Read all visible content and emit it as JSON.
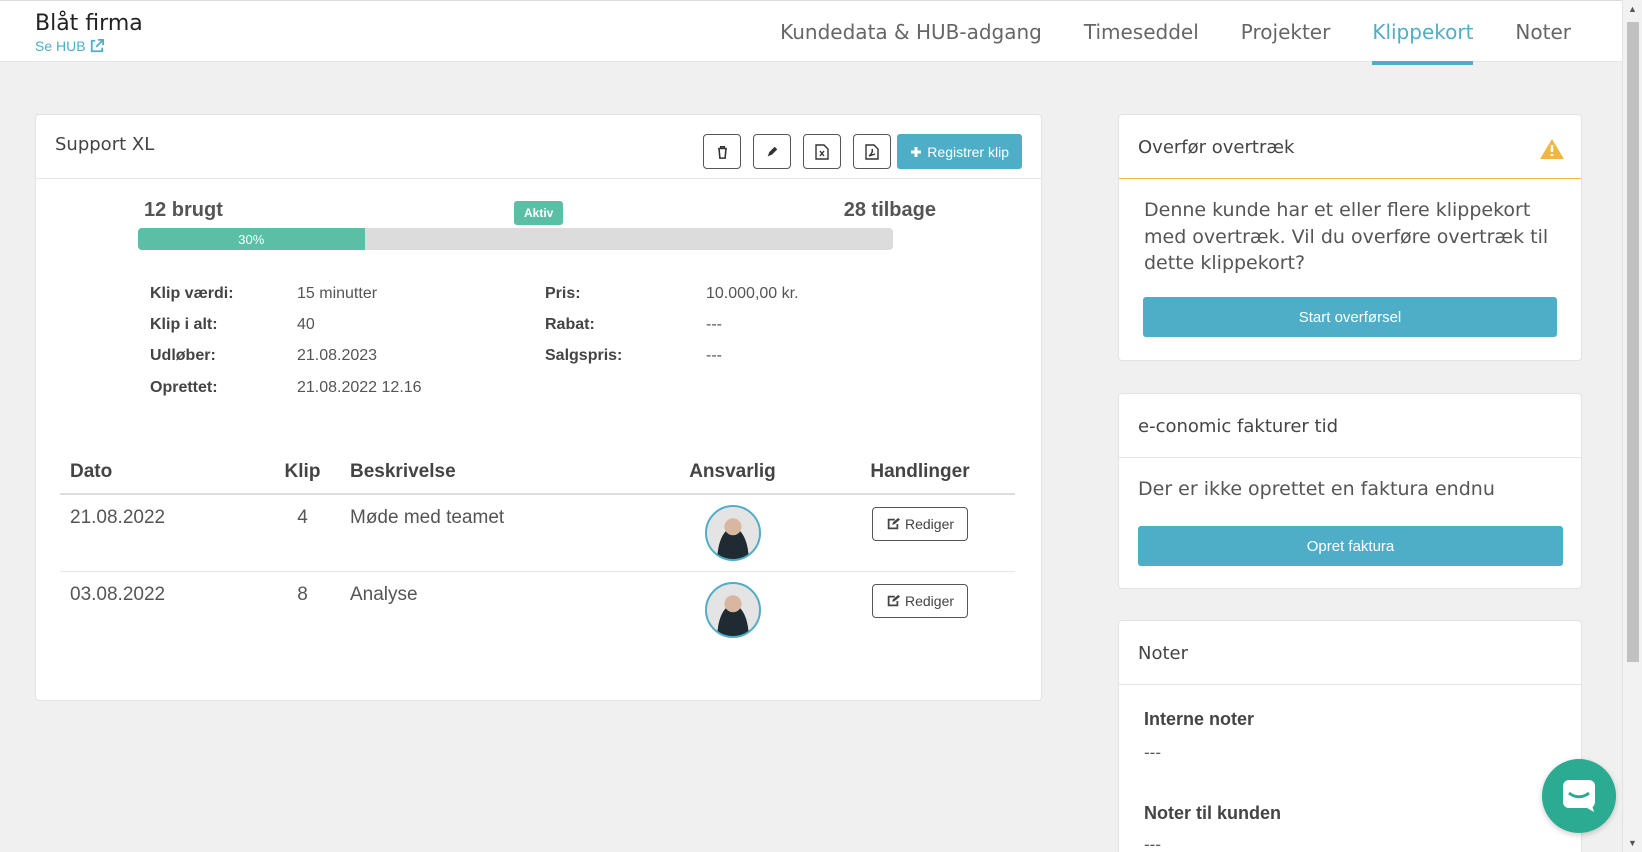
{
  "header": {
    "company": "Blåt firma",
    "hub_link": "Se HUB",
    "tabs": [
      {
        "label": "Kundedata & HUB-adgang"
      },
      {
        "label": "Timeseddel"
      },
      {
        "label": "Projekter"
      },
      {
        "label": "Klippekort",
        "active": true
      },
      {
        "label": "Noter"
      }
    ]
  },
  "card": {
    "title": "Support XL",
    "actions": [
      "trash-icon",
      "pencil-icon",
      "excel-icon",
      "pdf-icon"
    ],
    "register_label": "Registrer klip",
    "used": "12 brugt",
    "status": "Aktiv",
    "remaining": "28 tilbage",
    "progress_label": "30%",
    "progress_value": 0.3,
    "details": [
      {
        "label": "Klip værdi:",
        "value": "15 minutter"
      },
      {
        "label": "Klip i alt:",
        "value": "40"
      },
      {
        "label": "Udløber:",
        "value": "21.08.2023"
      },
      {
        "label": "Oprettet:",
        "value": "21.08.2022 12.16"
      },
      {
        "label": "Pris:",
        "value": "10.000,00 kr."
      },
      {
        "label": "Rabat:",
        "value": "---"
      },
      {
        "label": "Salgspris:",
        "value": "---"
      }
    ]
  },
  "table": {
    "headers": [
      "Dato",
      "Klip",
      "Beskrivelse",
      "Ansvarlig",
      "Handlinger"
    ],
    "rows": [
      {
        "date": "21.08.2022",
        "klip": "4",
        "description": "Møde med teamet",
        "action": "Rediger"
      },
      {
        "date": "03.08.2022",
        "klip": "8",
        "description": "Analyse",
        "action": "Rediger"
      }
    ]
  },
  "transfer": {
    "title": "Overfør overtræk",
    "text": "Denne kunde har et eller flere klippekort med overtræk. Vil du overføre overtræk til dette klippekort?",
    "button": "Start overførsel"
  },
  "economic": {
    "title": "e-conomic fakturer tid",
    "text": "Der er ikke oprettet en faktura endnu",
    "button": "Opret faktura"
  },
  "notes": {
    "title": "Noter",
    "internal_label": "Interne noter",
    "internal_value": "---",
    "customer_label": "Noter til kunden",
    "customer_value": "---"
  },
  "colors": {
    "accent": "#4eaec7",
    "success": "#5bbfa6",
    "warning": "#f2b642",
    "chat": "#2bab91"
  }
}
